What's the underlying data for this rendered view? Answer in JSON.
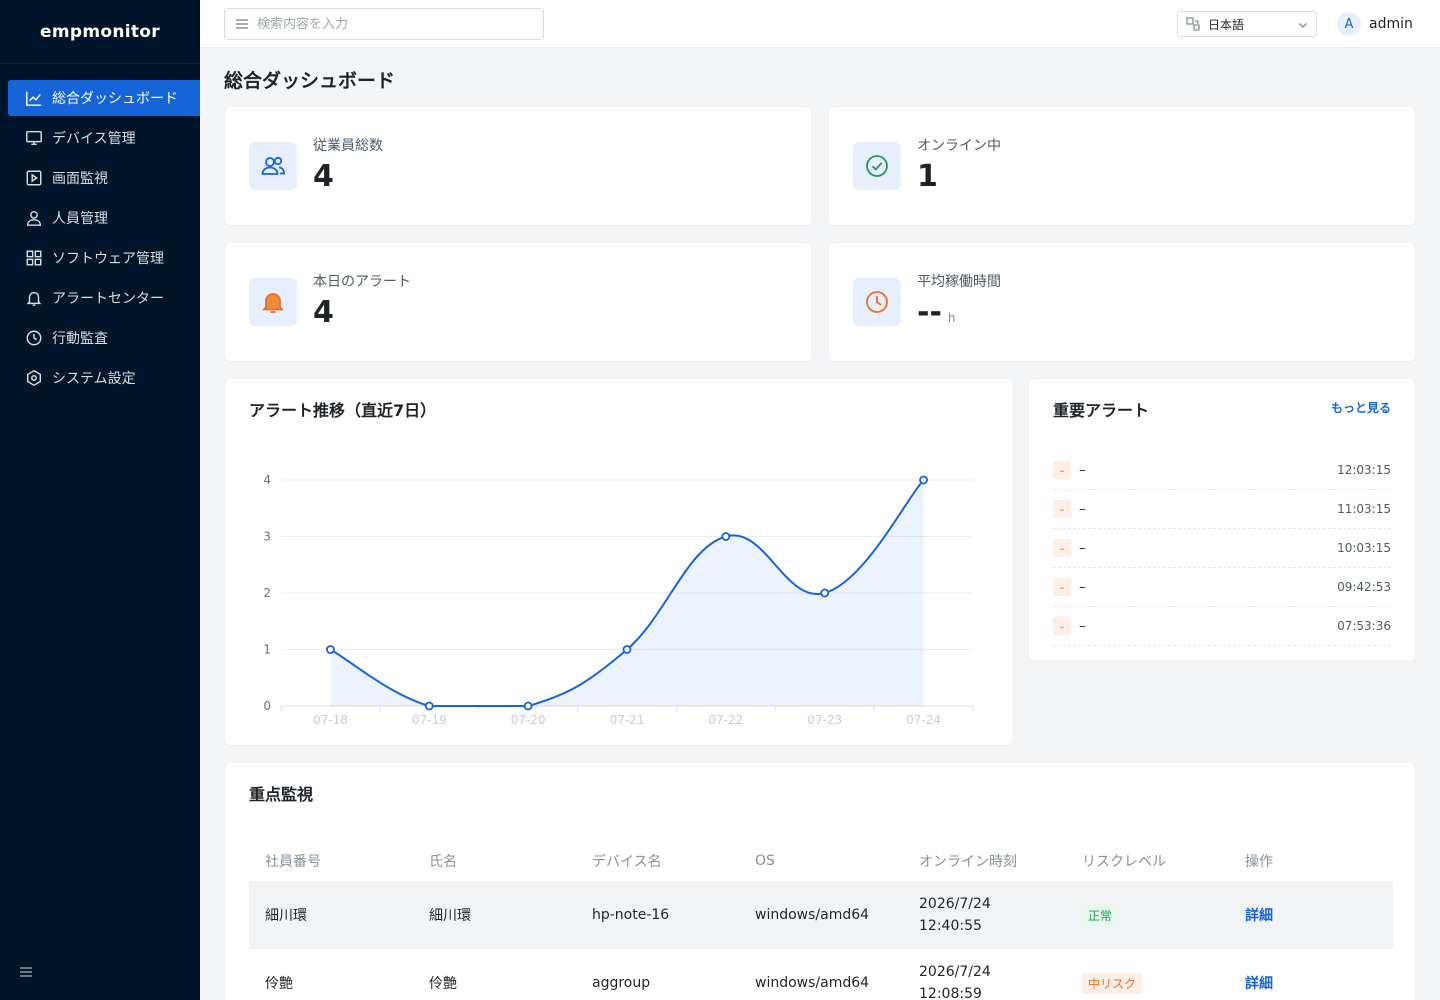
{
  "app": {
    "logo": "empmonitor"
  },
  "sidebar": {
    "items": [
      {
        "label": "総合ダッシュボード",
        "icon": "chart-line-icon",
        "active": true
      },
      {
        "label": "デバイス管理",
        "icon": "monitor-icon"
      },
      {
        "label": "画面監視",
        "icon": "play-square-icon"
      },
      {
        "label": "人員管理",
        "icon": "user-icon"
      },
      {
        "label": "ソフトウェア管理",
        "icon": "grid-icon"
      },
      {
        "label": "アラートセンター",
        "icon": "bell-icon"
      },
      {
        "label": "行動監査",
        "icon": "clock-icon"
      },
      {
        "label": "システム設定",
        "icon": "hexagon-settings-icon"
      }
    ]
  },
  "header": {
    "search_placeholder": "検索内容を入力",
    "language": "日本語",
    "user": {
      "initial": "A",
      "name": "admin"
    }
  },
  "page": {
    "title": "総合ダッシュボード"
  },
  "stats": [
    {
      "label": "従業員総数",
      "value": "4",
      "icon": "users-icon",
      "color": "#1565d8",
      "bg": "#e8effc"
    },
    {
      "label": "オンライン中",
      "value": "1",
      "icon": "check-circle-icon",
      "color": "#1f9d55",
      "bg": "#e6f6ec"
    },
    {
      "label": "本日のアラート",
      "value": "4",
      "icon": "bell-icon",
      "color": "#e8702a",
      "bg": "#eef3fc"
    },
    {
      "label": "平均稼働時間",
      "value": "--",
      "unit": "h",
      "icon": "clock-icon",
      "color": "#e8702a",
      "bg": "#eef3fc"
    }
  ],
  "alert_trend": {
    "title": "アラート推移（直近7日）"
  },
  "chart_data": {
    "type": "area",
    "title": "アラート推移（直近7日）",
    "categories": [
      "07-18",
      "07-19",
      "07-20",
      "07-21",
      "07-22",
      "07-23",
      "07-24"
    ],
    "series": [
      {
        "values": [
          1,
          0,
          0,
          1,
          3,
          2,
          4
        ]
      }
    ],
    "ylim": [
      0,
      4
    ],
    "yticks": [
      0,
      1,
      2,
      3,
      4
    ],
    "grid": true,
    "color": "#1565d8"
  },
  "important_alerts": {
    "title": "重要アラート",
    "more": "もっと見る",
    "items": [
      {
        "tag": "–",
        "text": "–",
        "time": "12:03:15"
      },
      {
        "tag": "–",
        "text": "–",
        "time": "11:03:15"
      },
      {
        "tag": "–",
        "text": "–",
        "time": "10:03:15"
      },
      {
        "tag": "–",
        "text": "–",
        "time": "09:42:53"
      },
      {
        "tag": "–",
        "text": "–",
        "time": "07:53:36"
      }
    ]
  },
  "focus_monitoring": {
    "title": "重点監視",
    "columns": [
      "社員番号",
      "氏名",
      "デバイス名",
      "OS",
      "オンライン時刻",
      "リスクレベル",
      "操作"
    ],
    "rows": [
      {
        "id": "細川環",
        "name": "細川環",
        "device": "hp-note-16",
        "os": "windows/amd64",
        "date": "2026/7/24",
        "time": "12:40:55",
        "risk": "正常",
        "risk_level": "ok",
        "action": "詳細"
      },
      {
        "id": "伶艶",
        "name": "伶艶",
        "device": "aggroup",
        "os": "windows/amd64",
        "date": "2026/7/24",
        "time": "12:08:59",
        "risk": "中リスク",
        "risk_level": "mid",
        "action": "詳細"
      }
    ]
  }
}
